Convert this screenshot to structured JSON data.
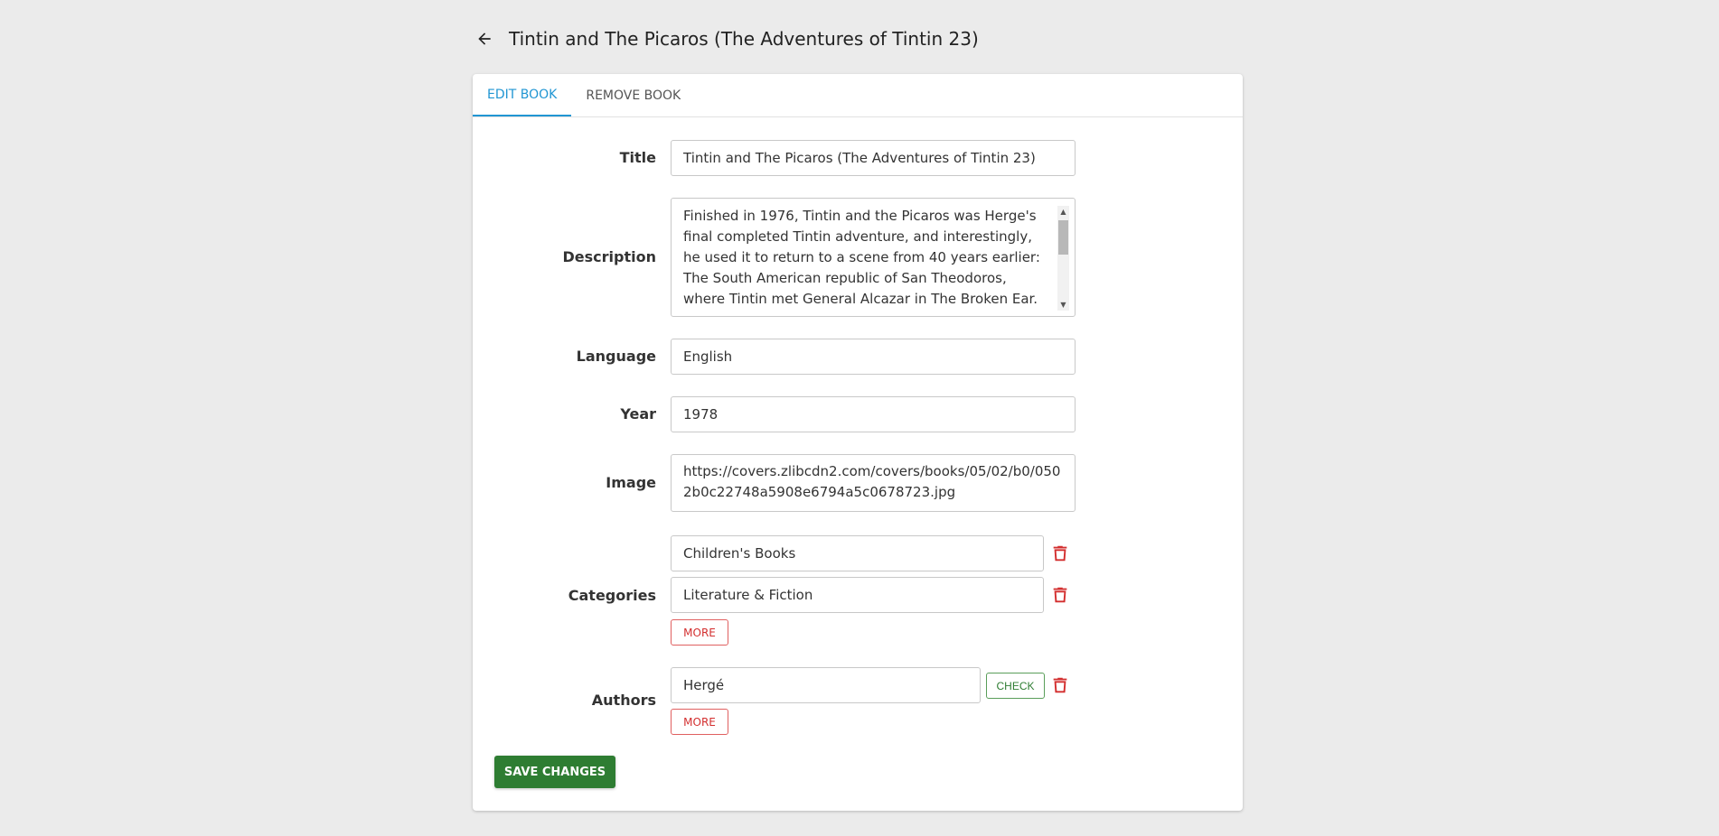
{
  "header": {
    "title": "Tintin and The Picaros (The Adventures of Tintin 23)"
  },
  "tabs": [
    {
      "label": "Edit Book",
      "active": true
    },
    {
      "label": "Remove Book",
      "active": false
    }
  ],
  "form": {
    "title": {
      "label": "Title",
      "value": "Tintin and The Picaros (The Adventures of Tintin 23)"
    },
    "description": {
      "label": "Description",
      "value": "Finished in 1976, Tintin and the Picaros was Herge's final completed Tintin adventure, and interestingly, he used it to return to a scene from 40 years earlier: The South American republic of San Theodoros, where Tintin met General Alcazar in The Broken Ear."
    },
    "language": {
      "label": "Language",
      "value": "English"
    },
    "year": {
      "label": "Year",
      "value": "1978"
    },
    "image": {
      "label": "Image",
      "value": "https://covers.zlibcdn2.com/covers/books/05/02/b0/0502b0c22748a5908e6794a5c0678723.jpg"
    },
    "categories": {
      "label": "Categories",
      "items": [
        "Children's Books",
        "Literature & Fiction"
      ],
      "more_label": "More"
    },
    "authors": {
      "label": "Authors",
      "items": [
        "Hergé"
      ],
      "check_label": "Check",
      "more_label": "More"
    }
  },
  "actions": {
    "save_label": "Save Changes"
  },
  "colors": {
    "accent": "#2196d3",
    "danger": "#d32f2f",
    "success": "#2e7d32",
    "background": "#ebebeb"
  },
  "icons": {
    "back": "arrow-left-icon",
    "delete": "trash-icon"
  }
}
